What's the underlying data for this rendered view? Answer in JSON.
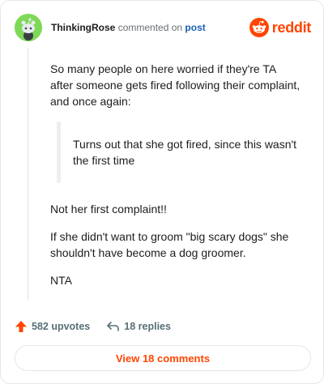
{
  "header": {
    "username": "ThinkingRose",
    "action_text": "commented on",
    "post_link": "post",
    "brand_wordmark": "reddit",
    "avatar_icon": "snoo-avatar-icon",
    "brand_color": "#ff4500"
  },
  "comment": {
    "paragraph_1": "So many people on here worried if they're TA after someone gets fired following their complaint, and once again:",
    "quote": "Turns out that she got fired, since this wasn't the first time",
    "paragraph_2": "Not her first complaint!!",
    "paragraph_3": "If she didn't want to groom \"big scary dogs\" she shouldn't have become a dog groomer.",
    "paragraph_4": "NTA"
  },
  "stats": {
    "upvotes": "582 upvotes",
    "replies": "18 replies",
    "upvote_icon": "upvote-arrow-icon",
    "reply_icon": "reply-arrow-icon"
  },
  "footer": {
    "view_comments_label": "View 18 comments"
  }
}
